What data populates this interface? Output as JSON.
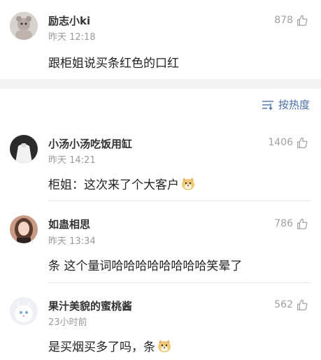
{
  "top_comment": {
    "username": "励志小ki",
    "time": "昨天 12:18",
    "likes": "878",
    "content": "跟柜姐说买条红色的口红"
  },
  "sort": {
    "label": "按热度",
    "icon": "sort-icon"
  },
  "comments": [
    {
      "username": "小汤小汤吃饭用缸",
      "time": "昨天 14:21",
      "likes": "1406",
      "content": "柜姐：这次来了个大客户",
      "emoji": "doge-emoji"
    },
    {
      "username": "如蛊相思",
      "time": "昨天 13:34",
      "likes": "786",
      "content": "条 这个量词哈哈哈哈哈哈哈哈笑晕了"
    },
    {
      "username": "果汁美貌的蜜桃酱",
      "time": "23小时前",
      "likes": "562",
      "content": "是买烟买多了吗，条",
      "emoji": "doge-emoji"
    }
  ],
  "colors": {
    "link": "#4a6fa5",
    "muted": "#9a9a9a",
    "gap": "#f2f2f2"
  }
}
